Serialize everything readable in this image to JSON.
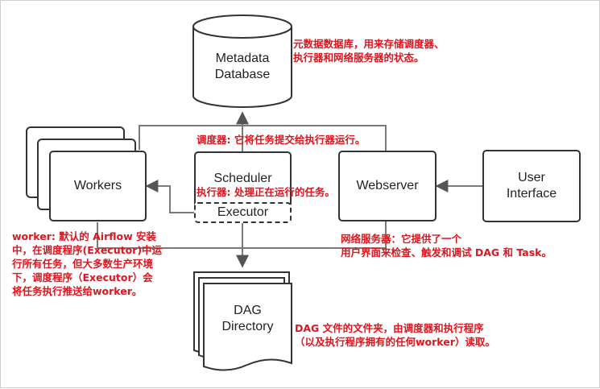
{
  "nodes": {
    "metadata_db": "Metadata\nDatabase",
    "workers": "Workers",
    "scheduler": "Scheduler",
    "executor": "Executor",
    "webserver": "Webserver",
    "user_interface": "User\nInterface",
    "dag_directory": "DAG\nDirectory"
  },
  "annotations": {
    "metadata_db": "元数据数据库，用来存储调度器、\n执行器和网络服务器的状态。",
    "scheduler": "调度器: 它将任务提交给执行器运行。",
    "executor": "执行器: 处理正在运行的任务。",
    "worker": "worker:  默认的 Airflow 安装\n中，在调度程序(Executor)中运\n行所有任务，但大多数生产环境\n下，调度程序（Executor）会\n将任务执行推送给worker。",
    "webserver": "网络服务器：它提供了一个\n用户界面来检查、触发和调试 DAG 和 Task。",
    "dag_directory": "DAG 文件的文件夹，由调度器和执行程序\n（以及执行程序拥有的任何worker）读取。"
  },
  "colors": {
    "line": "#333333",
    "connector": "#7a7a7a",
    "annotation": "#e0141e"
  }
}
